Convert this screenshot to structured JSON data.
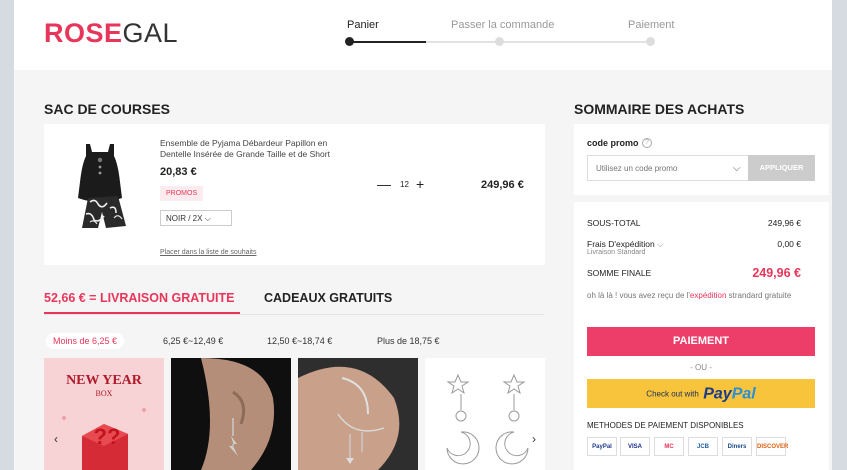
{
  "logo": {
    "rose": "ROSE",
    "gal": "GAL"
  },
  "steps": [
    {
      "label": "Panier",
      "active": true
    },
    {
      "label": "Passer la commande",
      "active": false
    },
    {
      "label": "Paiement",
      "active": false
    }
  ],
  "cart": {
    "title": "SAC DE COURSES",
    "item": {
      "name": "Ensemble de Pyjama Débardeur Papillon en Dentelle Insérée de Grande Taille et de Short",
      "price": "20,83 €",
      "promo": "PROMOS",
      "variant": "NOIR / 2X",
      "quantity": "12",
      "qty_minus": "—",
      "qty_plus": "+",
      "total": "249,96 €",
      "wishlist": "Placer dans la liste de souhaits"
    }
  },
  "shipping_tabs": {
    "free_shipping": "52,66 € = LIVRAISON GRATUITE",
    "free_gifts": "CADEAUX GRATUITS"
  },
  "price_ranges": [
    "Moins de 6,25 €",
    "6,25 €~12,49 €",
    "12,50 €~18,74 €",
    "Plus de 18,75 €"
  ],
  "gifts": [
    {
      "name": "new-year-box",
      "text_line1": "NEW YEAR",
      "text_line2": "BOX"
    },
    {
      "name": "lightning-earring"
    },
    {
      "name": "ear-cuff-chain"
    },
    {
      "name": "star-moon-earrings"
    }
  ],
  "carousel": {
    "prev": "‹",
    "next": "›"
  },
  "summary": {
    "title": "SOMMAIRE DES ACHATS",
    "promo_label": "code promo",
    "help": "?",
    "promo_placeholder": "Utilisez un code promo",
    "apply": "APPLIQUER",
    "subtotal_label": "SOUS-TOTAL",
    "subtotal_value": "249,96 €",
    "shipping_label": "Frais D'expédition",
    "shipping_sub": "Livraison Standard",
    "shipping_value": "0,00 €",
    "final_label": "SOMME FINALE",
    "final_value": "249,96 €",
    "note_before": "oh là là ! vous avez reçu de l'",
    "note_highlight": "expédition",
    "note_after": " strandard gratuite",
    "pay_button": "PAIEMENT",
    "or": "- OU -",
    "paypal_checkout": "Check out with",
    "paypal_pay": "Pay",
    "paypal_pal": "Pal",
    "methods_title": "METHODES DE PAIEMENT DISPONIBLES",
    "methods": [
      "PayPal",
      "VISA",
      "MC",
      "JCB",
      "Diners",
      "DISCOVER"
    ]
  },
  "colors": {
    "accent": "#e8355a",
    "paypal_yellow": "#f7c43c",
    "background": "#f5f5f5"
  }
}
